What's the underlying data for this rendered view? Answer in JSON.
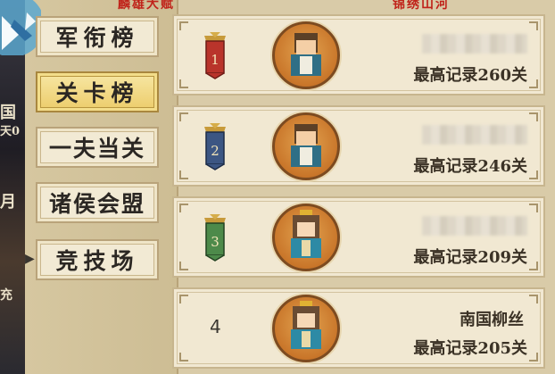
{
  "header": {
    "left_title": "麟雄大赋",
    "right_title": "锦绣山河"
  },
  "tabs": [
    {
      "label": "军衔榜",
      "active": false
    },
    {
      "label": "关卡榜",
      "active": true
    },
    {
      "label": "一夫当关",
      "active": false
    },
    {
      "label": "诸侯会盟",
      "active": false
    },
    {
      "label": "竞技场",
      "active": false
    }
  ],
  "left_fragments": [
    "国",
    "天0",
    "月",
    "充"
  ],
  "rankings": [
    {
      "rank": "1",
      "name": "",
      "record": "最高记录260关",
      "medal_color": "#b9342b"
    },
    {
      "rank": "2",
      "name": "",
      "record": "最高记录246关",
      "medal_color": "#3c5683"
    },
    {
      "rank": "3",
      "name": "",
      "record": "最高记录209关",
      "medal_color": "#4d8a4a"
    },
    {
      "rank": "4",
      "name": "南国柳丝",
      "record": "最高记录205关",
      "medal_color": ""
    }
  ],
  "colors": {
    "gold": "#eccc6a",
    "panel": "#f1e8d2",
    "red": "#c0231a"
  }
}
